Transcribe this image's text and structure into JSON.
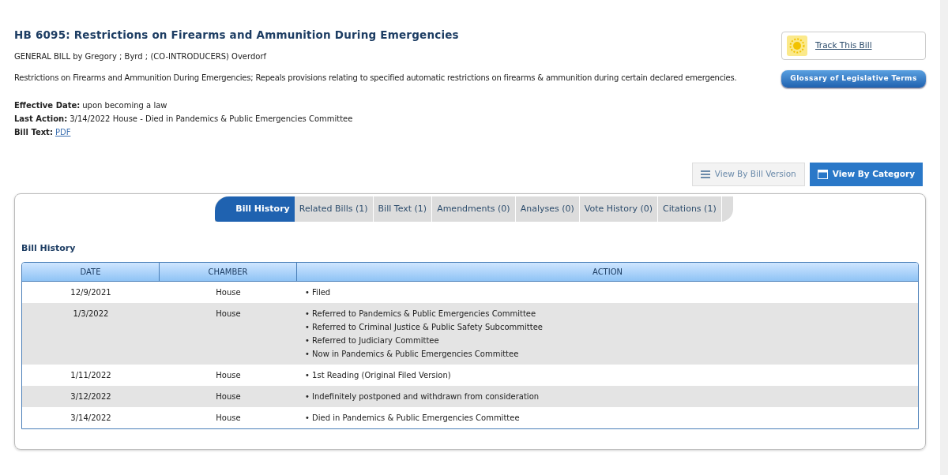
{
  "bill": {
    "title": "HB 6095: Restrictions on Firearms and Ammunition During Emergencies",
    "sponsors": "GENERAL BILL by Gregory ; Byrd ; (CO-INTRODUCERS) Overdorf",
    "description": "Restrictions on Firearms and Ammunition During Emergencies; Repeals provisions relating to specified automatic restrictions on firearms & ammunition during certain declared emergencies."
  },
  "fields": [
    {
      "label": "Effective Date:",
      "value": "upon becoming a law",
      "kind": "text"
    },
    {
      "label": "Last Action:",
      "value": "3/14/2022 House - Died in Pandemics & Public Emergencies Committee",
      "kind": "text"
    },
    {
      "label": "Bill Text:",
      "value": "PDF",
      "kind": "link"
    }
  ],
  "track": {
    "label": "Track This Bill"
  },
  "glossary": {
    "label": "Glossary of Legislative Terms"
  },
  "view_buttons": [
    {
      "label": "View By Bill Version",
      "kind": "list",
      "selected": false
    },
    {
      "label": "View By Category",
      "kind": "category",
      "selected": true
    }
  ],
  "tabs": [
    {
      "label": "Bill History",
      "selected": true
    },
    {
      "label": "Related Bills (1)",
      "selected": false
    },
    {
      "label": "Bill Text (1)",
      "selected": false
    },
    {
      "label": "Amendments (0)",
      "selected": false
    },
    {
      "label": "Analyses (0)",
      "selected": false
    },
    {
      "label": "Vote History (0)",
      "selected": false
    },
    {
      "label": "Citations (1)",
      "selected": false
    }
  ],
  "section_title": "Bill History",
  "table": {
    "columns": [
      "DATE",
      "CHAMBER",
      "ACTION"
    ],
    "rows": [
      {
        "date": "12/9/2021",
        "chamber": "House",
        "actions": [
          "• Filed"
        ]
      },
      {
        "date": "1/3/2022",
        "chamber": "House",
        "actions": [
          "• Referred to Pandemics & Public Emergencies Committee",
          "• Referred to Criminal Justice & Public Safety Subcommittee",
          "• Referred to Judiciary Committee",
          "• Now in Pandemics & Public Emergencies Committee"
        ]
      },
      {
        "date": "1/11/2022",
        "chamber": "House",
        "actions": [
          "• 1st Reading (Original Filed Version)"
        ]
      },
      {
        "date": "3/12/2022",
        "chamber": "House",
        "actions": [
          "• Indefinitely postponed and withdrawn from consideration"
        ]
      },
      {
        "date": "3/14/2022",
        "chamber": "House",
        "actions": [
          "• Died in Pandemics & Public Emergencies Committee"
        ]
      }
    ]
  }
}
